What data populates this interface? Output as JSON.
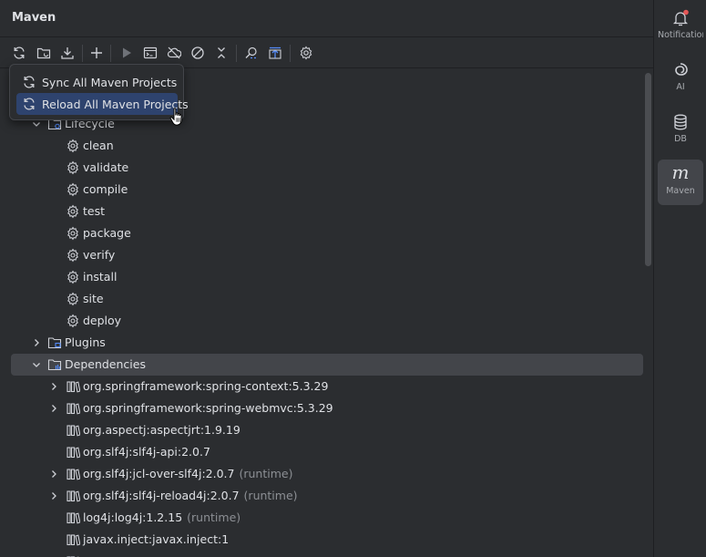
{
  "panel": {
    "title": "Maven"
  },
  "toolbar": {
    "buttons": [
      {
        "name": "reload-icon"
      },
      {
        "name": "generate-sources-icon"
      },
      {
        "name": "download-icon"
      },
      {
        "name": "add-icon"
      },
      {
        "name": "run-icon"
      },
      {
        "name": "execute-goal-icon"
      },
      {
        "name": "offline-mode-icon"
      },
      {
        "name": "skip-tests-icon"
      },
      {
        "name": "collapse-all-icon"
      },
      {
        "name": "analyze-dependencies-icon"
      },
      {
        "name": "show-diagram-icon"
      },
      {
        "name": "settings-icon"
      }
    ]
  },
  "popup_menu": {
    "items": [
      {
        "label": "Sync All Maven Projects",
        "icon": "sync-icon",
        "hovered": false
      },
      {
        "label": "Reload All Maven Projects",
        "icon": "reload-icon",
        "hovered": true
      }
    ]
  },
  "tree": {
    "rows": [
      {
        "label": "Lifecycle",
        "scope": "",
        "level": 1,
        "chevron": "down",
        "icon": "folder-gear-icon",
        "selected": false
      },
      {
        "label": "clean",
        "scope": "",
        "level": 2,
        "chevron": "none",
        "icon": "goal-gear-icon",
        "selected": false
      },
      {
        "label": "validate",
        "scope": "",
        "level": 2,
        "chevron": "none",
        "icon": "goal-gear-icon",
        "selected": false
      },
      {
        "label": "compile",
        "scope": "",
        "level": 2,
        "chevron": "none",
        "icon": "goal-gear-icon",
        "selected": false
      },
      {
        "label": "test",
        "scope": "",
        "level": 2,
        "chevron": "none",
        "icon": "goal-gear-icon",
        "selected": false
      },
      {
        "label": "package",
        "scope": "",
        "level": 2,
        "chevron": "none",
        "icon": "goal-gear-icon",
        "selected": false
      },
      {
        "label": "verify",
        "scope": "",
        "level": 2,
        "chevron": "none",
        "icon": "goal-gear-icon",
        "selected": false
      },
      {
        "label": "install",
        "scope": "",
        "level": 2,
        "chevron": "none",
        "icon": "goal-gear-icon",
        "selected": false
      },
      {
        "label": "site",
        "scope": "",
        "level": 2,
        "chevron": "none",
        "icon": "goal-gear-icon",
        "selected": false
      },
      {
        "label": "deploy",
        "scope": "",
        "level": 2,
        "chevron": "none",
        "icon": "goal-gear-icon",
        "selected": false
      },
      {
        "label": "Plugins",
        "scope": "",
        "level": 1,
        "chevron": "right",
        "icon": "folder-plugins-icon",
        "selected": false
      },
      {
        "label": "Dependencies",
        "scope": "",
        "level": 1,
        "chevron": "down",
        "icon": "folder-dependencies-icon",
        "selected": true
      },
      {
        "label": "org.springframework:spring-context:5.3.29",
        "scope": "",
        "level": 2,
        "chevron": "right",
        "icon": "library-icon",
        "selected": false
      },
      {
        "label": "org.springframework:spring-webmvc:5.3.29",
        "scope": "",
        "level": 2,
        "chevron": "right",
        "icon": "library-icon",
        "selected": false
      },
      {
        "label": "org.aspectj:aspectjrt:1.9.19",
        "scope": "",
        "level": 2,
        "chevron": "none",
        "icon": "library-icon",
        "selected": false
      },
      {
        "label": "org.slf4j:slf4j-api:2.0.7",
        "scope": "",
        "level": 2,
        "chevron": "none",
        "icon": "library-icon",
        "selected": false
      },
      {
        "label": "org.slf4j:jcl-over-slf4j:2.0.7",
        "scope": "(runtime)",
        "level": 2,
        "chevron": "right",
        "icon": "library-icon",
        "selected": false
      },
      {
        "label": "org.slf4j:slf4j-reload4j:2.0.7",
        "scope": "(runtime)",
        "level": 2,
        "chevron": "right",
        "icon": "library-icon",
        "selected": false
      },
      {
        "label": "log4j:log4j:1.2.15",
        "scope": "(runtime)",
        "level": 2,
        "chevron": "none",
        "icon": "library-icon",
        "selected": false
      },
      {
        "label": "javax.inject:javax.inject:1",
        "scope": "",
        "level": 2,
        "chevron": "none",
        "icon": "library-icon",
        "selected": false
      },
      {
        "label": "",
        "scope": "",
        "level": 2,
        "chevron": "none",
        "icon": "library-icon",
        "selected": false
      }
    ]
  },
  "right_strip": {
    "items": [
      {
        "label": "Notifications",
        "icon": "bell-icon",
        "active": false,
        "has_badge": true
      },
      {
        "label": "AI",
        "icon": "ai-spiral-icon",
        "active": false,
        "has_badge": false
      },
      {
        "label": "DB",
        "icon": "database-icon",
        "active": false,
        "has_badge": false
      },
      {
        "label": "Maven",
        "icon": "maven-icon",
        "active": true,
        "has_badge": false
      }
    ]
  },
  "colors": {
    "background": "#2b2d30",
    "selection": "#43454a",
    "menu_hover": "#2e436e",
    "text": "#dfe1e5",
    "secondary_text": "#8c8f94",
    "badge": "#e55757"
  }
}
